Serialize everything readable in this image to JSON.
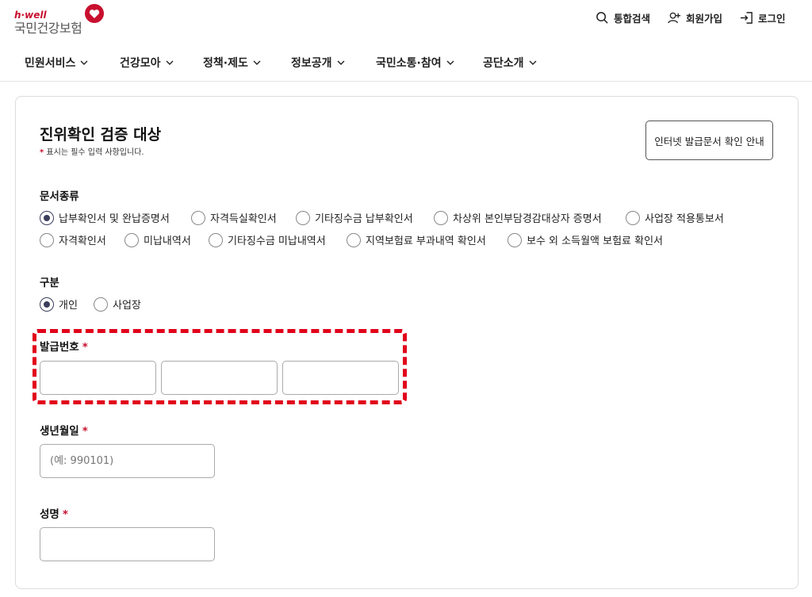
{
  "header": {
    "logo_small": "h·well",
    "logo_name": "국민건강보험",
    "search_label": "통합검색",
    "signup_label": "회원가입",
    "login_label": "로그인"
  },
  "gnb": [
    "민원서비스",
    "건강모아",
    "정책·제도",
    "정보공개",
    "국민소통·참여",
    "공단소개"
  ],
  "form": {
    "title": "진위확인 검증 대상",
    "required_note": "표시는 필수 입력 사항입니다.",
    "guide_button": "인터넷 발급문서 확인 안내",
    "doc_type_label": "문서종류",
    "doc_types": [
      {
        "label": "납부확인서 및 완납증명서",
        "checked": true
      },
      {
        "label": "자격득실확인서",
        "checked": false
      },
      {
        "label": "기타징수금 납부확인서",
        "checked": false
      },
      {
        "label": "차상위 본인부담경감대상자 증명서",
        "checked": false
      },
      {
        "label": "사업장 적용통보서",
        "checked": false
      },
      {
        "label": "자격확인서",
        "checked": false
      },
      {
        "label": "미납내역서",
        "checked": false
      },
      {
        "label": "기타징수금 미납내역서",
        "checked": false
      },
      {
        "label": "지역보험료 부과내역 확인서",
        "checked": false
      },
      {
        "label": "보수 외 소득월액 보험료 확인서",
        "checked": false
      }
    ],
    "category_label": "구분",
    "categories": [
      {
        "label": "개인",
        "checked": true
      },
      {
        "label": "사업장",
        "checked": false
      }
    ],
    "issue_no_label": "발급번호",
    "birth_label": "생년월일",
    "birth_placeholder": "(예: 990101)",
    "name_label": "성명",
    "required_mark": "*"
  },
  "colors": {
    "brand": "#c8102e",
    "radio_active": "#3b3f5c",
    "highlight": "#e1001a"
  }
}
